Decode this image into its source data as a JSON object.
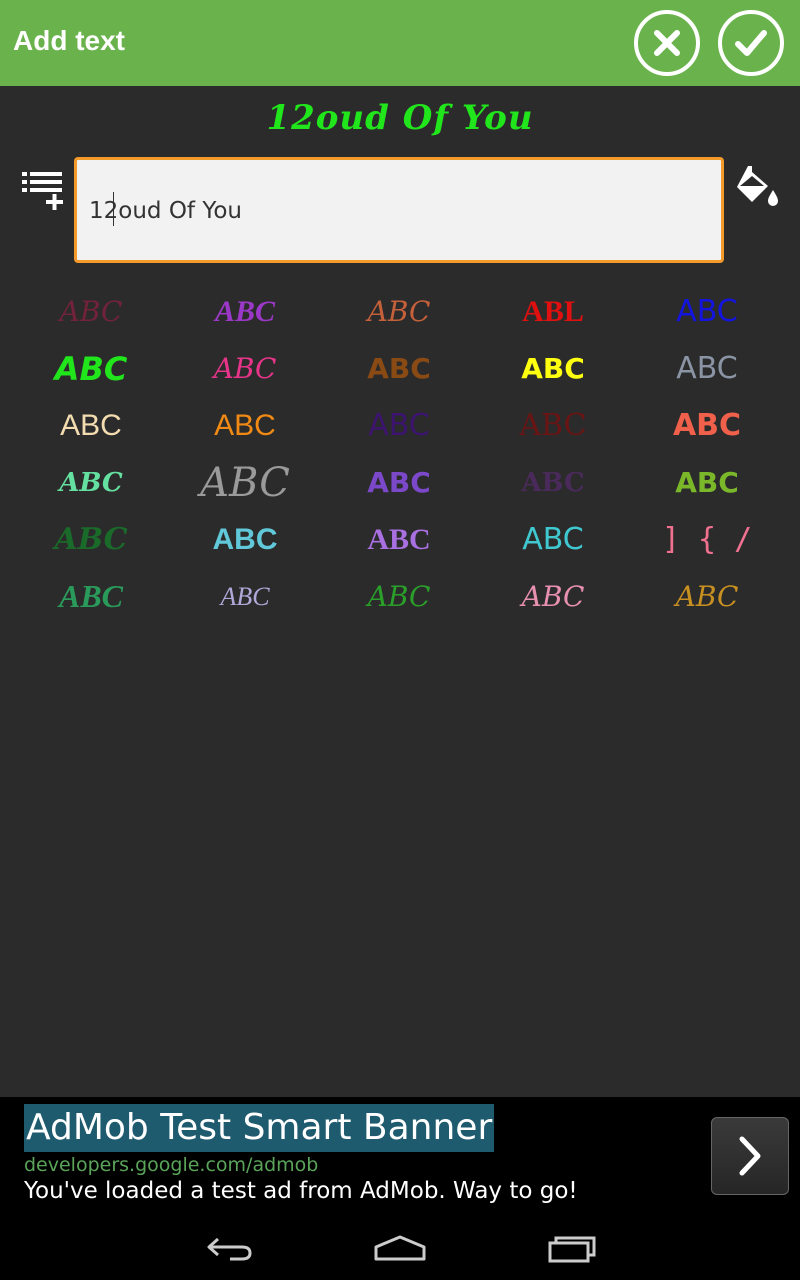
{
  "topbar": {
    "title": "Add text",
    "cancel_icon": "close-icon",
    "confirm_icon": "check-icon",
    "background": "#6ab34c"
  },
  "editor": {
    "preview_text": "12oud Of You",
    "preview_color": "#22e61c",
    "input_value": "12oud Of You",
    "input_border_color": "#f39a2b",
    "list_add_icon": "list-add-icon",
    "paint_icon": "paint-bucket-icon"
  },
  "fonts": [
    {
      "label": "ABC",
      "color": "#8a2040"
    },
    {
      "label": "ABC",
      "color": "#9b38c8"
    },
    {
      "label": "ABC",
      "color": "#c4603a"
    },
    {
      "label": "ABL",
      "color": "#e01010"
    },
    {
      "label": "ABC",
      "color": "#1414e0"
    },
    {
      "label": "ABC",
      "color": "#22e61c"
    },
    {
      "label": "ABC",
      "color": "#e8348a"
    },
    {
      "label": "ABC",
      "color": "#8a4a14"
    },
    {
      "label": "ABC",
      "color": "#ffff10"
    },
    {
      "label": "ABC",
      "color": "#8a94a4"
    },
    {
      "label": "ABC",
      "color": "#f2dcb0"
    },
    {
      "label": "ABC",
      "color": "#f08a14"
    },
    {
      "label": "ABC",
      "color": "#3c1470"
    },
    {
      "label": "ABC",
      "color": "#6a1414"
    },
    {
      "label": "ABC",
      "color": "#f0604a"
    },
    {
      "label": "ABC",
      "color": "#64e0a0"
    },
    {
      "label": "ABC",
      "color": "#9a9a9a"
    },
    {
      "label": "ABC",
      "color": "#7a48c8"
    },
    {
      "label": "ABC",
      "color": "#4a2a5a"
    },
    {
      "label": "ABC",
      "color": "#7ab82a"
    },
    {
      "label": "ABC",
      "color": "#1a6a2a"
    },
    {
      "label": "ABC",
      "color": "#60c8d8"
    },
    {
      "label": "ABC",
      "color": "#a870e0"
    },
    {
      "label": "ABC",
      "color": "#40c8d0"
    },
    {
      "label": "] { /",
      "color": "#f07090"
    },
    {
      "label": "ABC",
      "color": "#2a9a5a"
    },
    {
      "label": "ABC",
      "color": "#b0a8d8"
    },
    {
      "label": "ABC",
      "color": "#2aa02a"
    },
    {
      "label": "ABC",
      "color": "#e890b0"
    },
    {
      "label": "ABC",
      "color": "#c89020"
    }
  ],
  "ad": {
    "title": "AdMob Test Smart Banner",
    "url": "developers.google.com/admob",
    "description": "You've loaded a test ad from AdMob. Way to go!",
    "arrow_icon": "chevron-right-icon"
  },
  "navbar": {
    "back_icon": "back-icon",
    "home_icon": "home-icon",
    "recents_icon": "recents-icon"
  }
}
